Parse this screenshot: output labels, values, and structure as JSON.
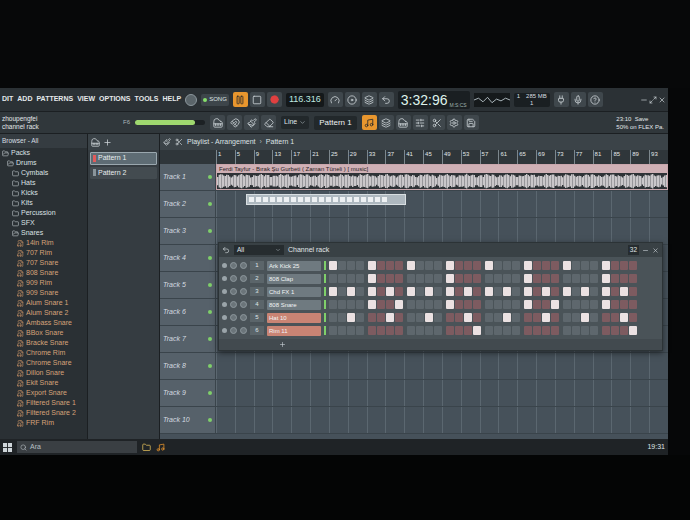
{
  "menu": [
    "DIT",
    "ADD",
    "PATTERNS",
    "VIEW",
    "OPTIONS",
    "TOOLS",
    "HELP"
  ],
  "transport": {
    "mode": "SONG",
    "song_mode": true,
    "playing": true,
    "tempo": "116.316",
    "time": "3:32:96",
    "time_unit": "M:S:CS"
  },
  "monitor": {
    "cpu": "1",
    "memory": "285 MB",
    "poly": "1"
  },
  "hint": {
    "user": "zhoupengfei",
    "text": "channel rack",
    "key": "F6"
  },
  "master_volume": {
    "level": 0.85
  },
  "snap": "Line",
  "pattern_selector": "Pattern 1",
  "view_buttons": [
    {
      "selected": true
    },
    {
      "selected": false
    },
    {
      "selected": false
    },
    {
      "selected": false
    },
    {
      "selected": false
    },
    {
      "selected": false
    }
  ],
  "info": {
    "line1": "23:10  Save",
    "line2": "50% on FLEX Pa."
  },
  "browser": {
    "title": "Browser - All",
    "items": [
      {
        "label": "Packs",
        "depth": 0,
        "kind": "folder",
        "expanded": true
      },
      {
        "label": "Drums",
        "depth": 1,
        "kind": "folder",
        "expanded": true
      },
      {
        "label": "Cymbals",
        "depth": 2,
        "kind": "folder",
        "expanded": false
      },
      {
        "label": "Hats",
        "depth": 2,
        "kind": "folder",
        "expanded": false
      },
      {
        "label": "Kicks",
        "depth": 2,
        "kind": "folder",
        "expanded": false
      },
      {
        "label": "Kits",
        "depth": 2,
        "kind": "folder",
        "expanded": false
      },
      {
        "label": "Percussion",
        "depth": 2,
        "kind": "folder",
        "expanded": false
      },
      {
        "label": "SFX",
        "depth": 2,
        "kind": "folder",
        "expanded": false
      },
      {
        "label": "Snares",
        "depth": 2,
        "kind": "folder",
        "expanded": true
      },
      {
        "label": "14in Rim",
        "depth": 3,
        "kind": "sample",
        "expanded": false
      },
      {
        "label": "707 Rim",
        "depth": 3,
        "kind": "sample",
        "expanded": false
      },
      {
        "label": "707 Snare",
        "depth": 3,
        "kind": "sample",
        "expanded": false
      },
      {
        "label": "808 Snare",
        "depth": 3,
        "kind": "sample",
        "expanded": false
      },
      {
        "label": "909 Rim",
        "depth": 3,
        "kind": "sample",
        "expanded": false
      },
      {
        "label": "909 Snare",
        "depth": 3,
        "kind": "sample",
        "expanded": false
      },
      {
        "label": "Alum Snare 1",
        "depth": 3,
        "kind": "sample",
        "expanded": false
      },
      {
        "label": "Alum Snare 2",
        "depth": 3,
        "kind": "sample",
        "expanded": false
      },
      {
        "label": "Ambass Snare",
        "depth": 3,
        "kind": "sample",
        "expanded": false
      },
      {
        "label": "BBox Snare",
        "depth": 3,
        "kind": "sample",
        "expanded": false
      },
      {
        "label": "Bracke Snare",
        "depth": 3,
        "kind": "sample",
        "expanded": false
      },
      {
        "label": "Chrome Rim",
        "depth": 3,
        "kind": "sample",
        "expanded": false
      },
      {
        "label": "Chrome Snare",
        "depth": 3,
        "kind": "sample",
        "expanded": false
      },
      {
        "label": "Dillon Snare",
        "depth": 3,
        "kind": "sample",
        "expanded": false
      },
      {
        "label": "Ekit Snare",
        "depth": 3,
        "kind": "sample",
        "expanded": false
      },
      {
        "label": "Export Snare",
        "depth": 3,
        "kind": "sample",
        "expanded": false
      },
      {
        "label": "Filtered Snare 1",
        "depth": 3,
        "kind": "sample",
        "expanded": false
      },
      {
        "label": "Filtered Snare 2",
        "depth": 3,
        "kind": "sample",
        "expanded": false
      },
      {
        "label": "FRF Rim",
        "depth": 3,
        "kind": "sample",
        "expanded": false
      }
    ]
  },
  "patterns": [
    {
      "label": "Pattern 1",
      "selected": true
    },
    {
      "label": "Pattern 2",
      "selected": false
    }
  ],
  "playlist": {
    "title": "Playlist - Arrangement",
    "sep": "›",
    "crumb": "Pattern 1",
    "ruler": [
      "1",
      "5",
      "9",
      "13",
      "17",
      "21",
      "25",
      "29",
      "33",
      "37",
      "41",
      "45",
      "49",
      "53",
      "57",
      "61",
      "65",
      "69",
      "73",
      "77",
      "81",
      "85",
      "89",
      "93"
    ],
    "tracks": [
      "Track 1",
      "Track 2",
      "Track 3",
      "Track 4",
      "Track 5",
      "Track 6",
      "Track 7",
      "Track 8",
      "Track 9",
      "Track 10"
    ],
    "audio_clip": {
      "track": "Track 1",
      "label": "Ferdi Tayfur - Bırak Şu Gurbeti ( Zaman Tüneli ) [ music]"
    },
    "pattern_clip": {
      "track": "Track 2"
    }
  },
  "channel_rack": {
    "filter": "All",
    "title": "Channel rack",
    "steps_count": "32",
    "channels": [
      {
        "number": "1",
        "name": "Ark Kick 25",
        "color": "#6f7a80",
        "steps": [
          true,
          false,
          false,
          false,
          true,
          false,
          false,
          false,
          true,
          false,
          false,
          false,
          true,
          false,
          false,
          false,
          true,
          false,
          false,
          false,
          true,
          false,
          false,
          false,
          true,
          false,
          false,
          false,
          true,
          false,
          false,
          false
        ]
      },
      {
        "number": "2",
        "name": "808 Clap",
        "color": "#6f7a80",
        "steps": [
          false,
          false,
          false,
          false,
          true,
          false,
          false,
          false,
          false,
          false,
          false,
          false,
          true,
          false,
          false,
          false,
          false,
          false,
          false,
          false,
          true,
          false,
          false,
          false,
          false,
          false,
          false,
          false,
          true,
          false,
          false,
          false
        ]
      },
      {
        "number": "3",
        "name": "Chd FX 1",
        "color": "#6f7a80",
        "steps": [
          true,
          false,
          true,
          false,
          true,
          false,
          true,
          false,
          true,
          false,
          true,
          false,
          true,
          false,
          true,
          false,
          true,
          false,
          true,
          false,
          true,
          false,
          true,
          false,
          true,
          false,
          true,
          false,
          true,
          false,
          true,
          false
        ]
      },
      {
        "number": "4",
        "name": "808 Snare",
        "color": "#6f7a80",
        "steps": [
          false,
          false,
          false,
          false,
          true,
          false,
          false,
          true,
          false,
          false,
          false,
          false,
          true,
          false,
          false,
          false,
          false,
          false,
          false,
          false,
          true,
          false,
          false,
          true,
          false,
          false,
          false,
          false,
          true,
          false,
          false,
          false
        ]
      },
      {
        "number": "5",
        "name": "Hat 10",
        "color": "#c98474",
        "steps": [
          false,
          false,
          true,
          false,
          false,
          false,
          true,
          false,
          false,
          false,
          true,
          false,
          false,
          false,
          true,
          false,
          false,
          false,
          true,
          false,
          false,
          false,
          true,
          false,
          false,
          false,
          true,
          false,
          false,
          false,
          true,
          false
        ]
      },
      {
        "number": "6",
        "name": "Rim 11",
        "color": "#c98474",
        "steps": [
          false,
          false,
          false,
          false,
          false,
          false,
          false,
          false,
          false,
          false,
          false,
          false,
          false,
          false,
          false,
          true,
          false,
          false,
          false,
          false,
          false,
          false,
          false,
          false,
          false,
          false,
          false,
          false,
          false,
          false,
          false,
          true
        ]
      }
    ]
  },
  "taskbar": {
    "search": "Ara",
    "time": "19:31"
  }
}
